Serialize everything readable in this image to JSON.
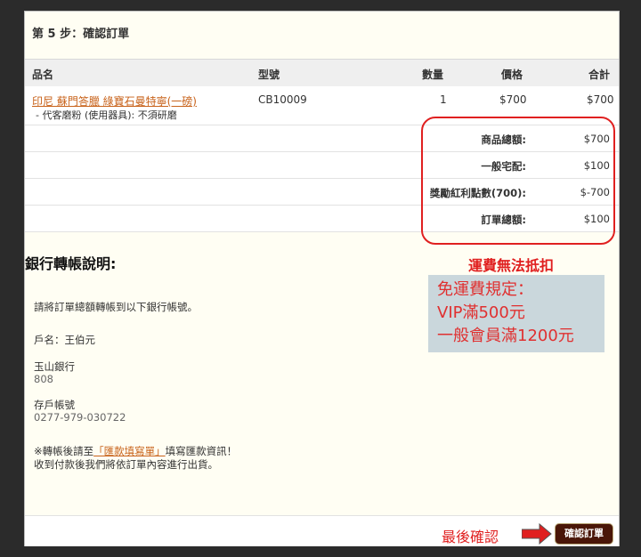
{
  "step": {
    "title": "第 5 步：確認訂單"
  },
  "table": {
    "headers": [
      "品名",
      "型號",
      "數量",
      "價格",
      "合計"
    ],
    "item": {
      "name": "印尼 蘇門答臘 綠寶石曼特寧(一磅)",
      "option": "- 代客磨粉 (使用器具): 不須研磨",
      "model": "CB10009",
      "qty": "1",
      "price": "$700",
      "total": "$700"
    }
  },
  "summary": [
    {
      "label": "商品總額:",
      "value": "$700"
    },
    {
      "label": "一般宅配:",
      "value": "$100"
    },
    {
      "label": "獎勵紅利點數(700):",
      "value": "$-700"
    },
    {
      "label": "訂單總額:",
      "value": "$100"
    }
  ],
  "notes": {
    "shipping": "運費無法抵扣",
    "free_rule_title": "免運費規定：",
    "free_rule_vip": "VIP滿500元",
    "free_rule_member": "一般會員滿1200元"
  },
  "bank": {
    "title": "銀行轉帳說明:",
    "intro": "請將訂單總額轉帳到以下銀行帳號。",
    "account_name": "戶名：王伯元",
    "bank_name": "玉山銀行",
    "bank_code": "808",
    "account_label": "存戶帳號",
    "account_number": "0277-979-030722",
    "after_prefix": "※轉帳後請至",
    "after_link": "「匯款填寫單」",
    "after_suffix": "填寫匯款資訊！",
    "after_line2": "收到付款後我們將依訂單內容進行出貨。"
  },
  "footer": {
    "final_confirm": "最後確認",
    "confirm_button": "確認訂單"
  },
  "colors": {
    "accent_red": "#e01f1f",
    "link_orange": "#c8621a",
    "button_brown": "#4a1608"
  }
}
